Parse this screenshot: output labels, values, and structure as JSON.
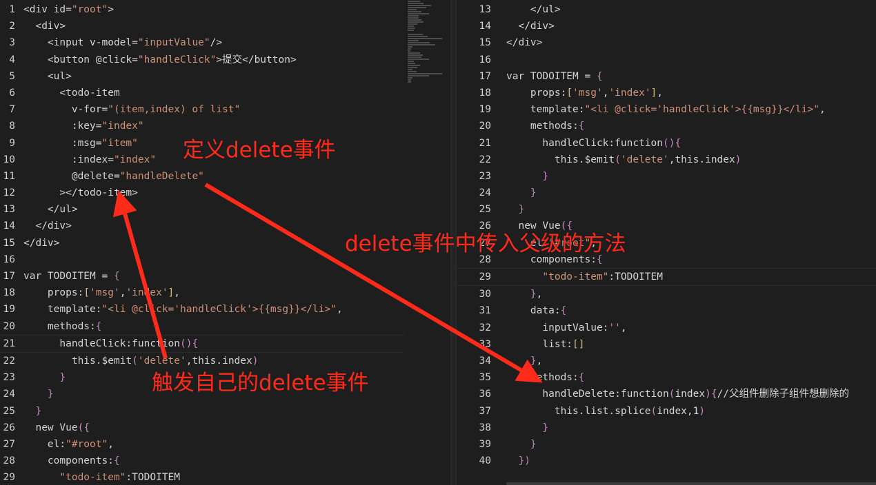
{
  "colors": {
    "annotation": "#ff2a1a",
    "background": "#1e1e1e",
    "string": "#ce9178",
    "brace": "#c586c0"
  },
  "left_editor": {
    "lines": [
      {
        "num": "1",
        "text": "<div id=\"root\">"
      },
      {
        "num": "2",
        "text": "  <div>"
      },
      {
        "num": "3",
        "text": "    <input v-model=\"inputValue\"/>"
      },
      {
        "num": "4",
        "text": "    <button @click=\"handleClick\">提交</button>"
      },
      {
        "num": "5",
        "text": "    <ul>"
      },
      {
        "num": "6",
        "text": "      <todo-item"
      },
      {
        "num": "7",
        "text": "        v-for=\"(item,index) of list\""
      },
      {
        "num": "8",
        "text": "        :key=\"index\""
      },
      {
        "num": "9",
        "text": "        :msg=\"item\""
      },
      {
        "num": "10",
        "text": "        :index=\"index\""
      },
      {
        "num": "11",
        "text": "        @delete=\"handleDelete\""
      },
      {
        "num": "12",
        "text": "      ></todo-item>"
      },
      {
        "num": "13",
        "text": "    </ul>"
      },
      {
        "num": "14",
        "text": "  </div>"
      },
      {
        "num": "15",
        "text": "</div>"
      },
      {
        "num": "16",
        "text": ""
      },
      {
        "num": "17",
        "text": "var TODOITEM = {"
      },
      {
        "num": "18",
        "text": "    props:['msg','index'],"
      },
      {
        "num": "19",
        "text": "    template:\"<li @click='handleClick'>{{msg}}</li>\","
      },
      {
        "num": "20",
        "text": "    methods:{"
      },
      {
        "num": "21",
        "text": "      handleClick:function(){"
      },
      {
        "num": "22",
        "text": "        this.$emit('delete',this.index)"
      },
      {
        "num": "23",
        "text": "      }"
      },
      {
        "num": "24",
        "text": "    }"
      },
      {
        "num": "25",
        "text": "  }"
      },
      {
        "num": "26",
        "text": "  new Vue({"
      },
      {
        "num": "27",
        "text": "    el:\"#root\","
      },
      {
        "num": "28",
        "text": "    components:{"
      },
      {
        "num": "29",
        "text": "      \"todo-item\":TODOITEM"
      }
    ]
  },
  "right_editor": {
    "lines": [
      {
        "num": "13",
        "text": "    </ul>"
      },
      {
        "num": "14",
        "text": "  </div>"
      },
      {
        "num": "15",
        "text": "</div>"
      },
      {
        "num": "16",
        "text": ""
      },
      {
        "num": "17",
        "text": "var TODOITEM = {"
      },
      {
        "num": "18",
        "text": "    props:['msg','index'],"
      },
      {
        "num": "19",
        "text": "    template:\"<li @click='handleClick'>{{msg}}</li>\","
      },
      {
        "num": "20",
        "text": "    methods:{"
      },
      {
        "num": "21",
        "text": "      handleClick:function(){"
      },
      {
        "num": "22",
        "text": "        this.$emit('delete',this.index)"
      },
      {
        "num": "23",
        "text": "      }"
      },
      {
        "num": "24",
        "text": "    }"
      },
      {
        "num": "25",
        "text": "  }"
      },
      {
        "num": "26",
        "text": "  new Vue({"
      },
      {
        "num": "27",
        "text": "    el:\"#root\","
      },
      {
        "num": "28",
        "text": "    components:{"
      },
      {
        "num": "29",
        "text": "      \"todo-item\":TODOITEM"
      },
      {
        "num": "30",
        "text": "    },"
      },
      {
        "num": "31",
        "text": "    data:{"
      },
      {
        "num": "32",
        "text": "      inputValue:'',"
      },
      {
        "num": "33",
        "text": "      list:[]"
      },
      {
        "num": "34",
        "text": "    },"
      },
      {
        "num": "35",
        "text": "    methods:{"
      },
      {
        "num": "36",
        "text": "      handleDelete:function(index){//父组件删除子组件想删除的"
      },
      {
        "num": "37",
        "text": "        this.list.splice(index,1)"
      },
      {
        "num": "38",
        "text": "      }"
      },
      {
        "num": "39",
        "text": "    }"
      },
      {
        "num": "40",
        "text": "  })"
      }
    ]
  },
  "annotations": {
    "define_event": "定义delete事件",
    "pass_parent_method": "delete事件中传入父级的方法",
    "trigger_event": "触发自己的delete事件"
  }
}
